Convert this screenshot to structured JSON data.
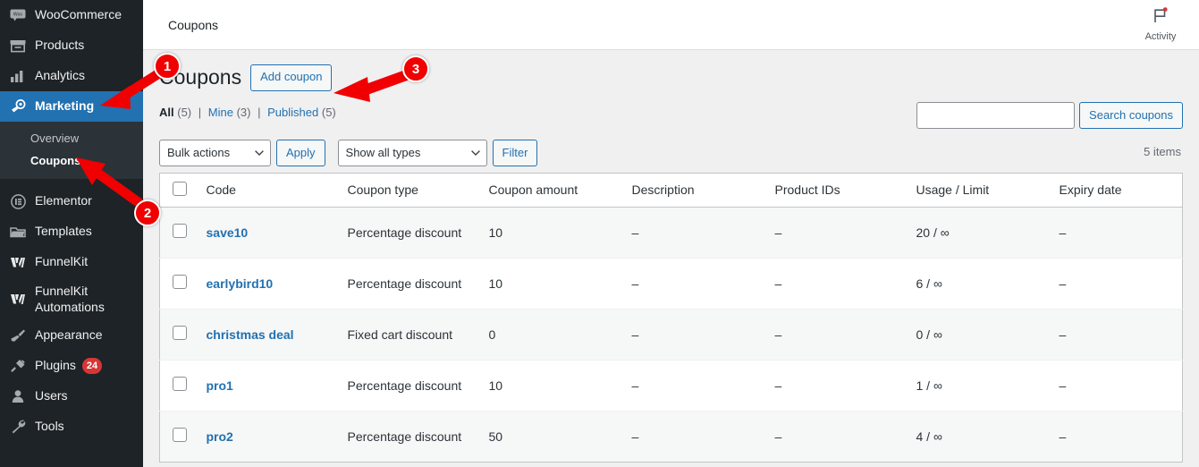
{
  "sidebar": {
    "items": [
      {
        "label": "WooCommerce",
        "icon": "woo-icon",
        "current": false
      },
      {
        "label": "Products",
        "icon": "products-icon",
        "current": false
      },
      {
        "label": "Analytics",
        "icon": "analytics-icon",
        "current": false
      },
      {
        "label": "Marketing",
        "icon": "megaphone-icon",
        "current": true
      }
    ],
    "submenu": [
      {
        "label": "Overview",
        "current": false
      },
      {
        "label": "Coupons",
        "current": true
      }
    ],
    "items_lower": [
      {
        "label": "Elementor",
        "icon": "elementor-icon",
        "badge": ""
      },
      {
        "label": "Templates",
        "icon": "folder-icon",
        "badge": ""
      },
      {
        "label": "FunnelKit",
        "icon": "funnelkit-icon",
        "badge": ""
      },
      {
        "label": "FunnelKit Automations",
        "icon": "funnelkit-icon",
        "badge": ""
      },
      {
        "label": "Appearance",
        "icon": "paintbrush-icon",
        "badge": ""
      },
      {
        "label": "Plugins",
        "icon": "plug-icon",
        "badge": "24"
      },
      {
        "label": "Users",
        "icon": "user-icon",
        "badge": ""
      },
      {
        "label": "Tools",
        "icon": "wrench-icon",
        "badge": ""
      }
    ]
  },
  "header": {
    "breadcrumb": "Coupons",
    "activity_label": "Activity"
  },
  "page": {
    "title": "Coupons",
    "add_button": "Add coupon",
    "items_count": "5 items"
  },
  "views": [
    {
      "label": "All",
      "count": "(5)",
      "current": true
    },
    {
      "label": "Mine",
      "count": "(3)",
      "current": false
    },
    {
      "label": "Published",
      "count": "(5)",
      "current": false
    }
  ],
  "search": {
    "value": "",
    "placeholder": "",
    "button": "Search coupons"
  },
  "tablenav": {
    "bulk_actions_selected": "Bulk actions",
    "bulk_actions_options": [
      "Bulk actions"
    ],
    "apply_label": "Apply",
    "type_filter_selected": "Show all types",
    "type_filter_options": [
      "Show all types"
    ],
    "filter_label": "Filter"
  },
  "table": {
    "columns": [
      "Code",
      "Coupon type",
      "Coupon amount",
      "Description",
      "Product IDs",
      "Usage / Limit",
      "Expiry date"
    ],
    "rows": [
      {
        "code": "save10",
        "type": "Percentage discount",
        "amount": "10",
        "description": "–",
        "product_ids": "–",
        "usage": "20 / ∞",
        "expiry": "–"
      },
      {
        "code": "earlybird10",
        "type": "Percentage discount",
        "amount": "10",
        "description": "–",
        "product_ids": "–",
        "usage": "6 / ∞",
        "expiry": "–"
      },
      {
        "code": "christmas deal",
        "type": "Fixed cart discount",
        "amount": "0",
        "description": "–",
        "product_ids": "–",
        "usage": "0 / ∞",
        "expiry": "–"
      },
      {
        "code": "pro1",
        "type": "Percentage discount",
        "amount": "10",
        "description": "–",
        "product_ids": "–",
        "usage": "1 / ∞",
        "expiry": "–"
      },
      {
        "code": "pro2",
        "type": "Percentage discount",
        "amount": "50",
        "description": "–",
        "product_ids": "–",
        "usage": "4 / ∞",
        "expiry": "–"
      }
    ]
  },
  "annotations": [
    {
      "number": "1",
      "target": "marketing-menu-item"
    },
    {
      "number": "2",
      "target": "coupons-submenu-item"
    },
    {
      "number": "3",
      "target": "add-coupon-button"
    }
  ],
  "colors": {
    "sidebar_bg": "#1d2327",
    "submenu_bg": "#2c3338",
    "accent_blue": "#2271b1",
    "badge_red": "#d63638",
    "annotation_red": "#f00000",
    "page_bg": "#f0f0f1"
  }
}
